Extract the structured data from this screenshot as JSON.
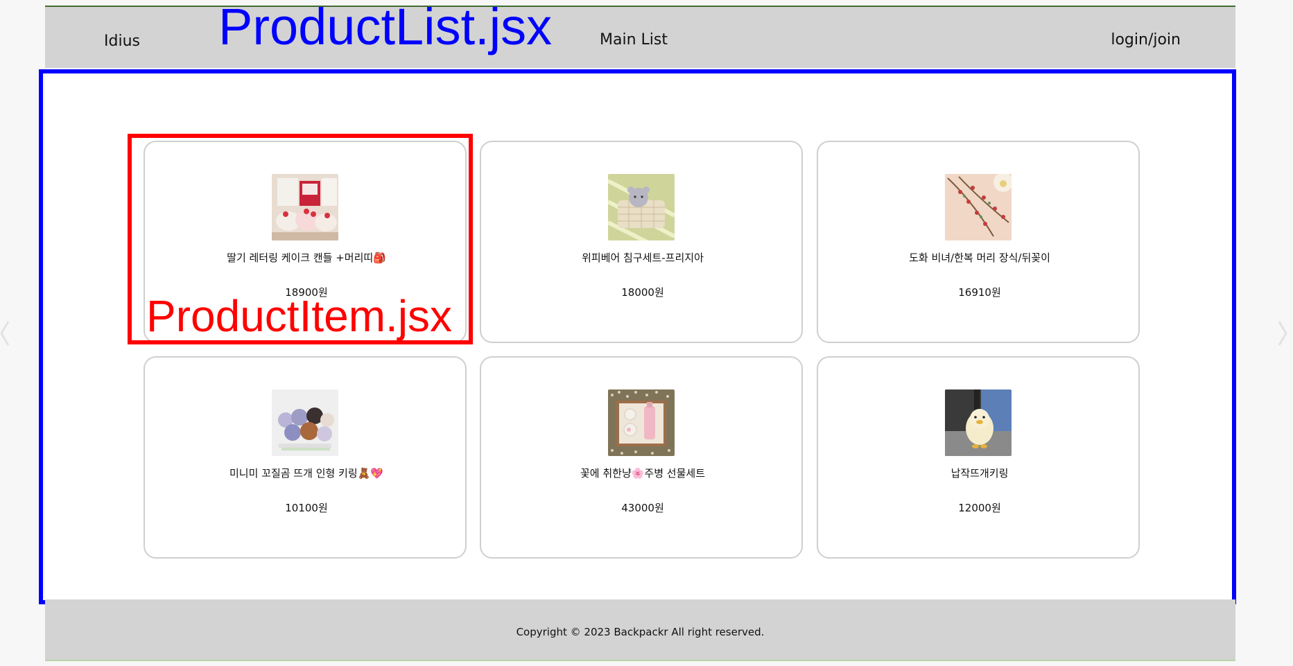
{
  "header": {
    "brand": "Idius",
    "nav_main_list": "Main List",
    "login_join": "login/join"
  },
  "annotations": {
    "product_list": "ProductList.jsx",
    "product_item": "ProductItem.jsx"
  },
  "products": [
    {
      "name": "딸기 레터링 케이크 캔들 +머리띠🎒",
      "price": "18900원",
      "image": "cake-candle-photo"
    },
    {
      "name": "위피베어 침구세트-프리지아",
      "price": "18000원",
      "image": "bear-bedding-photo"
    },
    {
      "name": "도화 비녀/한복 머리 장식/뒤꽂이",
      "price": "16910원",
      "image": "hairpin-photo"
    },
    {
      "name": "미니미 꼬질곰 뜨개 인형 키링🧸💖",
      "price": "10100원",
      "image": "knit-bears-photo"
    },
    {
      "name": "꽃에 취한냥🌸주병 선물세트",
      "price": "43000원",
      "image": "gift-box-photo"
    },
    {
      "name": "납작뜨개키링",
      "price": "12000원",
      "image": "duck-keyring-photo"
    }
  ],
  "footer": {
    "copyright": "Copyright © 2023 Backpackr All right reserved."
  },
  "colors": {
    "header_bg": "#d3d3d3",
    "list_annotation": "#0000ff",
    "item_annotation": "#ff0000",
    "card_border": "#cfcfcf"
  }
}
